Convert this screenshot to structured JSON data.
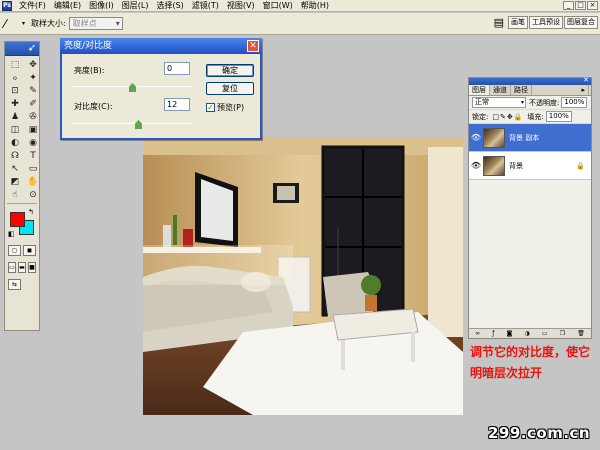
{
  "menubar": {
    "app_icon": "Ps",
    "items": [
      "文件(F)",
      "编辑(E)",
      "图像(I)",
      "图层(L)",
      "选择(S)",
      "滤镜(T)",
      "视图(V)",
      "窗口(W)",
      "帮助(H)"
    ],
    "window_controls": [
      "_",
      "□",
      "×"
    ]
  },
  "options_bar": {
    "tool_icon": "eyedropper-icon",
    "sample_size_label": "取样大小:",
    "sample_size_value": "取样点",
    "well_tabs": [
      "画笔",
      "工具预设",
      "图层复合"
    ]
  },
  "toolbox": {
    "tools": [
      "⬚",
      "✥",
      "ℴ",
      "✦",
      "⊡",
      "✎",
      "✚",
      "✐",
      "♟",
      "✇",
      "◫",
      "▣",
      "◐",
      "◉",
      "☊",
      "T",
      "↖",
      "▭",
      "◩",
      "✋",
      "☝",
      "⊙"
    ],
    "colors": {
      "foreground": "#ff0000",
      "background": "#00e5f0"
    }
  },
  "dialog": {
    "title": "亮度/对比度",
    "brightness_label": "亮度(B):",
    "brightness_value": "0",
    "brightness_level_pct": 50,
    "contrast_label": "对比度(C):",
    "contrast_value": "12",
    "contrast_level_pct": 55,
    "ok_label": "确定",
    "reset_label": "复位",
    "preview_label": "预览(P)",
    "preview_checked": true
  },
  "layers_panel": {
    "tabs": [
      "图层",
      "通道",
      "路径"
    ],
    "blend_mode": "正常",
    "opacity_label": "不透明度:",
    "opacity_value": "100%",
    "lock_label": "锁定:",
    "fill_label": "填充:",
    "fill_value": "100%",
    "layers": [
      {
        "name": "背景 副本",
        "selected": true,
        "locked": false
      },
      {
        "name": "背景",
        "selected": false,
        "locked": true
      }
    ]
  },
  "annotation": {
    "line1": "调节它的对比度，使它",
    "line2": "明暗层次拉开"
  },
  "watermark": "299.com.cn"
}
